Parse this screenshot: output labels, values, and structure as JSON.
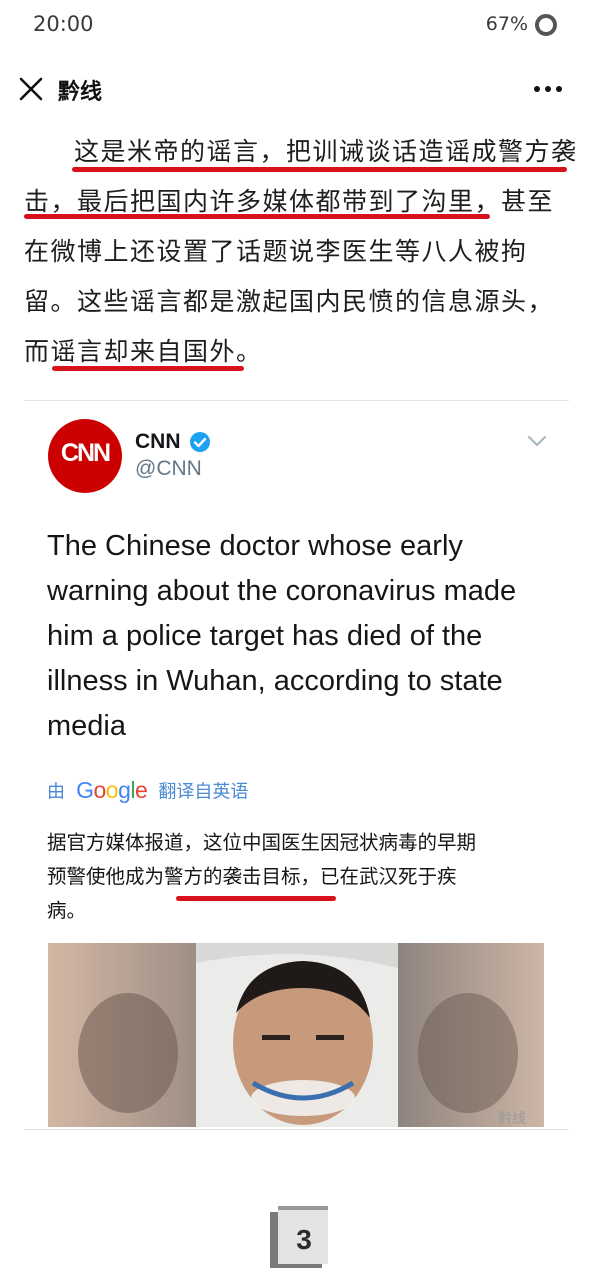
{
  "status_bar": {
    "time": "20:00",
    "battery": "67%"
  },
  "nav": {
    "title": "黔线",
    "close_icon": "close-icon",
    "more_icon": "more-icon"
  },
  "article": {
    "lines": [
      "这是米帝的谣言，把训诫谈话造谣成警方袭",
      "击，最后把国内许多媒体都带到了沟里，甚至",
      "在微博上还设置了话题说李医生等八人被拘",
      "留。这些谣言都是激起国内民愤的信息源头，",
      "而谣言却来自国外。"
    ],
    "highlight_color": "#d8121c"
  },
  "tweet": {
    "account_name": "CNN",
    "account_handle": "@CNN",
    "logo_text": "CNN",
    "text_lines": [
      "The Chinese doctor whose early",
      "warning about the coronavirus made",
      "him a police target has died of the",
      "illness in Wuhan, according to state",
      "media"
    ],
    "translate": {
      "by": "由",
      "google": "Google",
      "from": "翻译自英语"
    },
    "translation_lines": [
      "据官方媒体报道，这位中国医生因冠状病毒的早期",
      "预警使他成为警方的袭击目标，已在武汉死于疾",
      "病。"
    ]
  },
  "watermark": "黔线",
  "page_number": "3"
}
